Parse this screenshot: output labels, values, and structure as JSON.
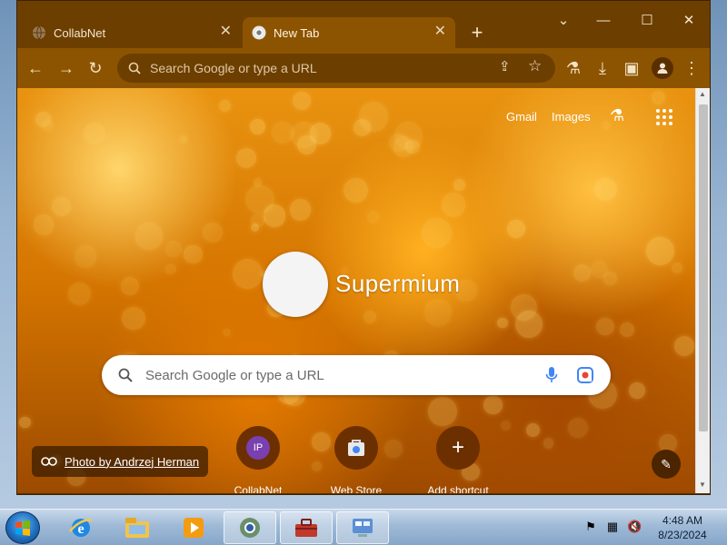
{
  "browser": {
    "tabs": [
      {
        "title": "CollabNet",
        "active": false
      },
      {
        "title": "New Tab",
        "active": true
      }
    ],
    "new_tab_symbol": "+",
    "window_controls": {
      "tab_search": "⌄",
      "minimize": "—",
      "maximize": "☐",
      "close": "✕"
    },
    "omnibox": {
      "placeholder": "Search Google or type a URL",
      "value": ""
    },
    "toolbar_icons": [
      "back-icon",
      "forward-icon",
      "reload-icon",
      "share-icon",
      "bookmark-star-icon",
      "labs-icon",
      "download-icon",
      "side-panel-icon",
      "profile-icon",
      "menu-icon"
    ]
  },
  "newtab": {
    "top_links": {
      "gmail": "Gmail",
      "images": "Images"
    },
    "logo_text": "Supermium",
    "search": {
      "placeholder": "Search Google or type a URL",
      "value": ""
    },
    "shortcuts": [
      {
        "label": "CollabNet",
        "badge": "IP"
      },
      {
        "label": "Web Store",
        "badge": ""
      },
      {
        "label": "Add shortcut",
        "badge": "+"
      }
    ],
    "photo_credit": "Photo by Andrzej Herman",
    "colors": {
      "accent": "#8c5400",
      "tabstrip": "#6c3f00",
      "shortcut_bg": "#6c3000"
    }
  },
  "taskbar": {
    "clock_time": "4:48 AM",
    "clock_date": "8/23/2024",
    "apps": [
      "internet-explorer-icon",
      "file-explorer-icon",
      "media-player-icon",
      "browser-icon",
      "toolbox-icon",
      "control-panel-icon"
    ]
  }
}
